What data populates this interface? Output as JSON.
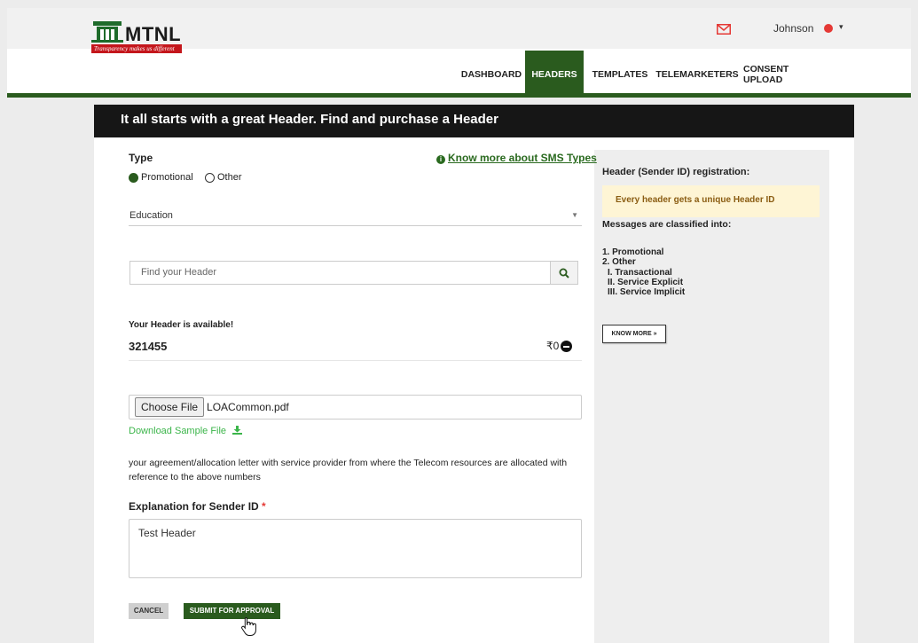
{
  "brand": {
    "name": "MTNL",
    "tagline": "Transparency makes us different"
  },
  "user": {
    "name": "Johnson"
  },
  "nav": {
    "dashboard": "DASHBOARD",
    "headers": "HEADERS",
    "templates": "TEMPLATES",
    "telemarketers": "TELEMARKETERS",
    "consent_upload": "CONSENT UPLOAD",
    "active": "HEADERS"
  },
  "panel": {
    "title": "It all starts with a great Header. Find and purchase a Header"
  },
  "form": {
    "type_label": "Type",
    "know_more_link": "Know more about SMS Types",
    "radio_promotional": "Promotional",
    "radio_other": "Other",
    "radio_selected": "Promotional",
    "category_value": "Education",
    "search_placeholder": "Find your Header",
    "available_label": "Your Header is available!",
    "header_number": "321455",
    "price": "₹0",
    "file_button": "Choose File",
    "file_name": "LOACommon.pdf",
    "download_sample": "Download Sample File",
    "agreement_text": "your agreement/allocation letter with service provider from where the Telecom resources are allocated with reference to the above numbers",
    "explanation_label": "Explanation for Sender ID",
    "required_mark": "*",
    "explanation_value": "Test Header",
    "cancel_label": "CANCEL",
    "submit_label": "SUBMIT FOR APPROVAL"
  },
  "sidebar": {
    "title": "Header (Sender ID) registration:",
    "note": "Every header gets a unique Header ID",
    "subtitle": "Messages are classified into:",
    "items": [
      "1. Promotional",
      "2. Other",
      "I. Transactional",
      "II. Service Explicit",
      "III. Service Implicit"
    ],
    "know_more": "KNOW MORE »"
  },
  "colors": {
    "brand_green": "#2a5b1e",
    "link_green": "#2a6a1f",
    "download_green": "#3bb54a",
    "header_black": "#161616",
    "note_bg": "#fef5d5",
    "required_red": "#e53935"
  },
  "icons": [
    "mail-icon",
    "user-icon",
    "chevron-down-icon",
    "info-icon",
    "search-icon",
    "remove-icon",
    "download-icon",
    "hand-cursor-icon"
  ]
}
